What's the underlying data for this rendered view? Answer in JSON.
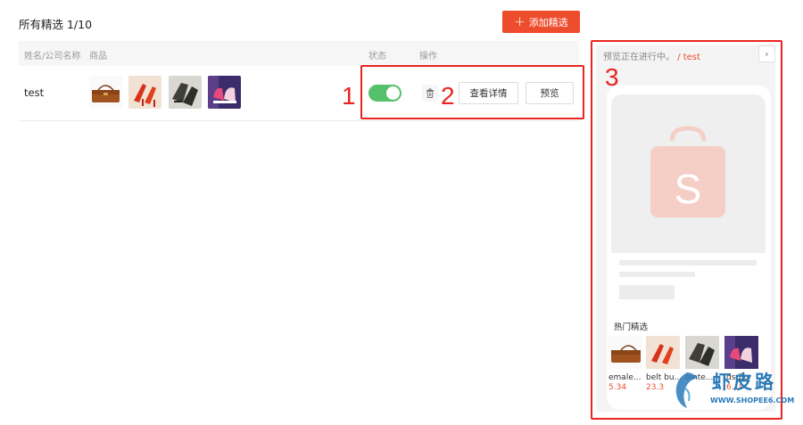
{
  "header": {
    "title": "所有精选 1/10",
    "add_button": "添加精选"
  },
  "table": {
    "columns": {
      "name": "姓名/公司名称",
      "products": "商品",
      "status": "状态",
      "actions": "操作"
    },
    "rows": [
      {
        "name": "test",
        "status_on": true,
        "view_button": "查看详情",
        "preview_button": "预览"
      }
    ]
  },
  "preview": {
    "status_text": "预览正在进行中。",
    "status_name": "/ test",
    "section_title": "热门精选",
    "products": [
      {
        "name": "emale...",
        "price": "5.34"
      },
      {
        "name": "belt bu...",
        "price": "23.3"
      },
      {
        "name": "ointe...",
        "price": ""
      },
      {
        "name": "ds Zo",
        "price": "6.19"
      }
    ]
  },
  "annotations": [
    "1",
    "2",
    "3"
  ],
  "watermark": {
    "cn": "虾皮路",
    "url": "WWW.SHOPEE6.COM"
  },
  "colors": {
    "brand": "#ee4d2d",
    "toggle_on": "#55c16a",
    "annotation": "#e8251f"
  },
  "icons": [
    "plus-icon",
    "trash-icon",
    "chevron-right-icon",
    "shopee-bag-icon"
  ]
}
